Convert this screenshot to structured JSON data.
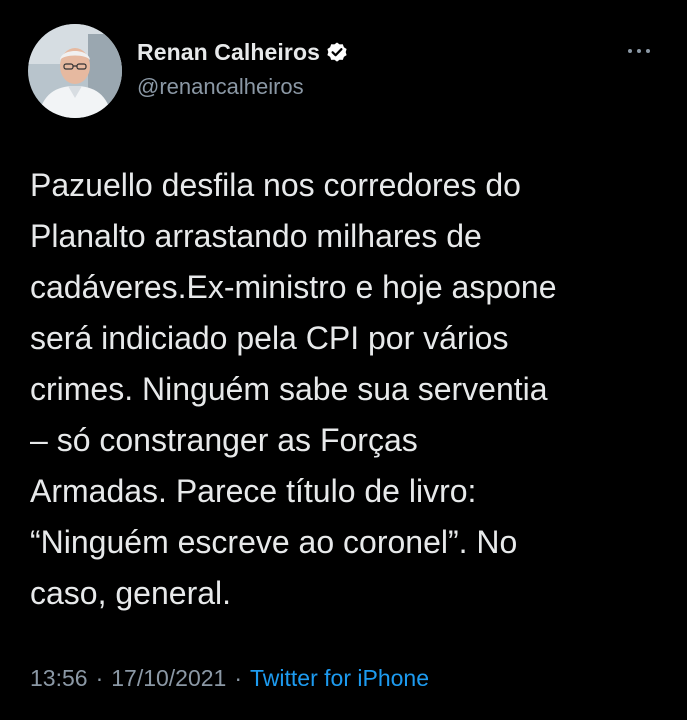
{
  "tweet": {
    "author": {
      "display_name": "Renan Calheiros",
      "handle": "@renancalheiros",
      "verified": true,
      "avatar_icon": "profile-photo"
    },
    "more_icon": "more-dots-icon",
    "text": "Pazuello desfila nos corredores do\nPlanalto arrastando milhares de\ncadáveres.Ex-ministro e hoje aspone\nserá indiciado pela CPI por vários\ncrimes. Ninguém sabe sua serventia\n– só constranger as Forças\nArmadas. Parece título de livro:\n“Ninguém escreve ao coronel”. No\ncaso, general.",
    "time": "13:56",
    "separator": "·",
    "date": "17/10/2021",
    "source": "Twitter for iPhone"
  },
  "colors": {
    "background": "#000000",
    "text": "#e7e9ea",
    "secondary": "#8b98a5",
    "link": "#1d9bf0",
    "verified_badge": "#ffffff"
  }
}
